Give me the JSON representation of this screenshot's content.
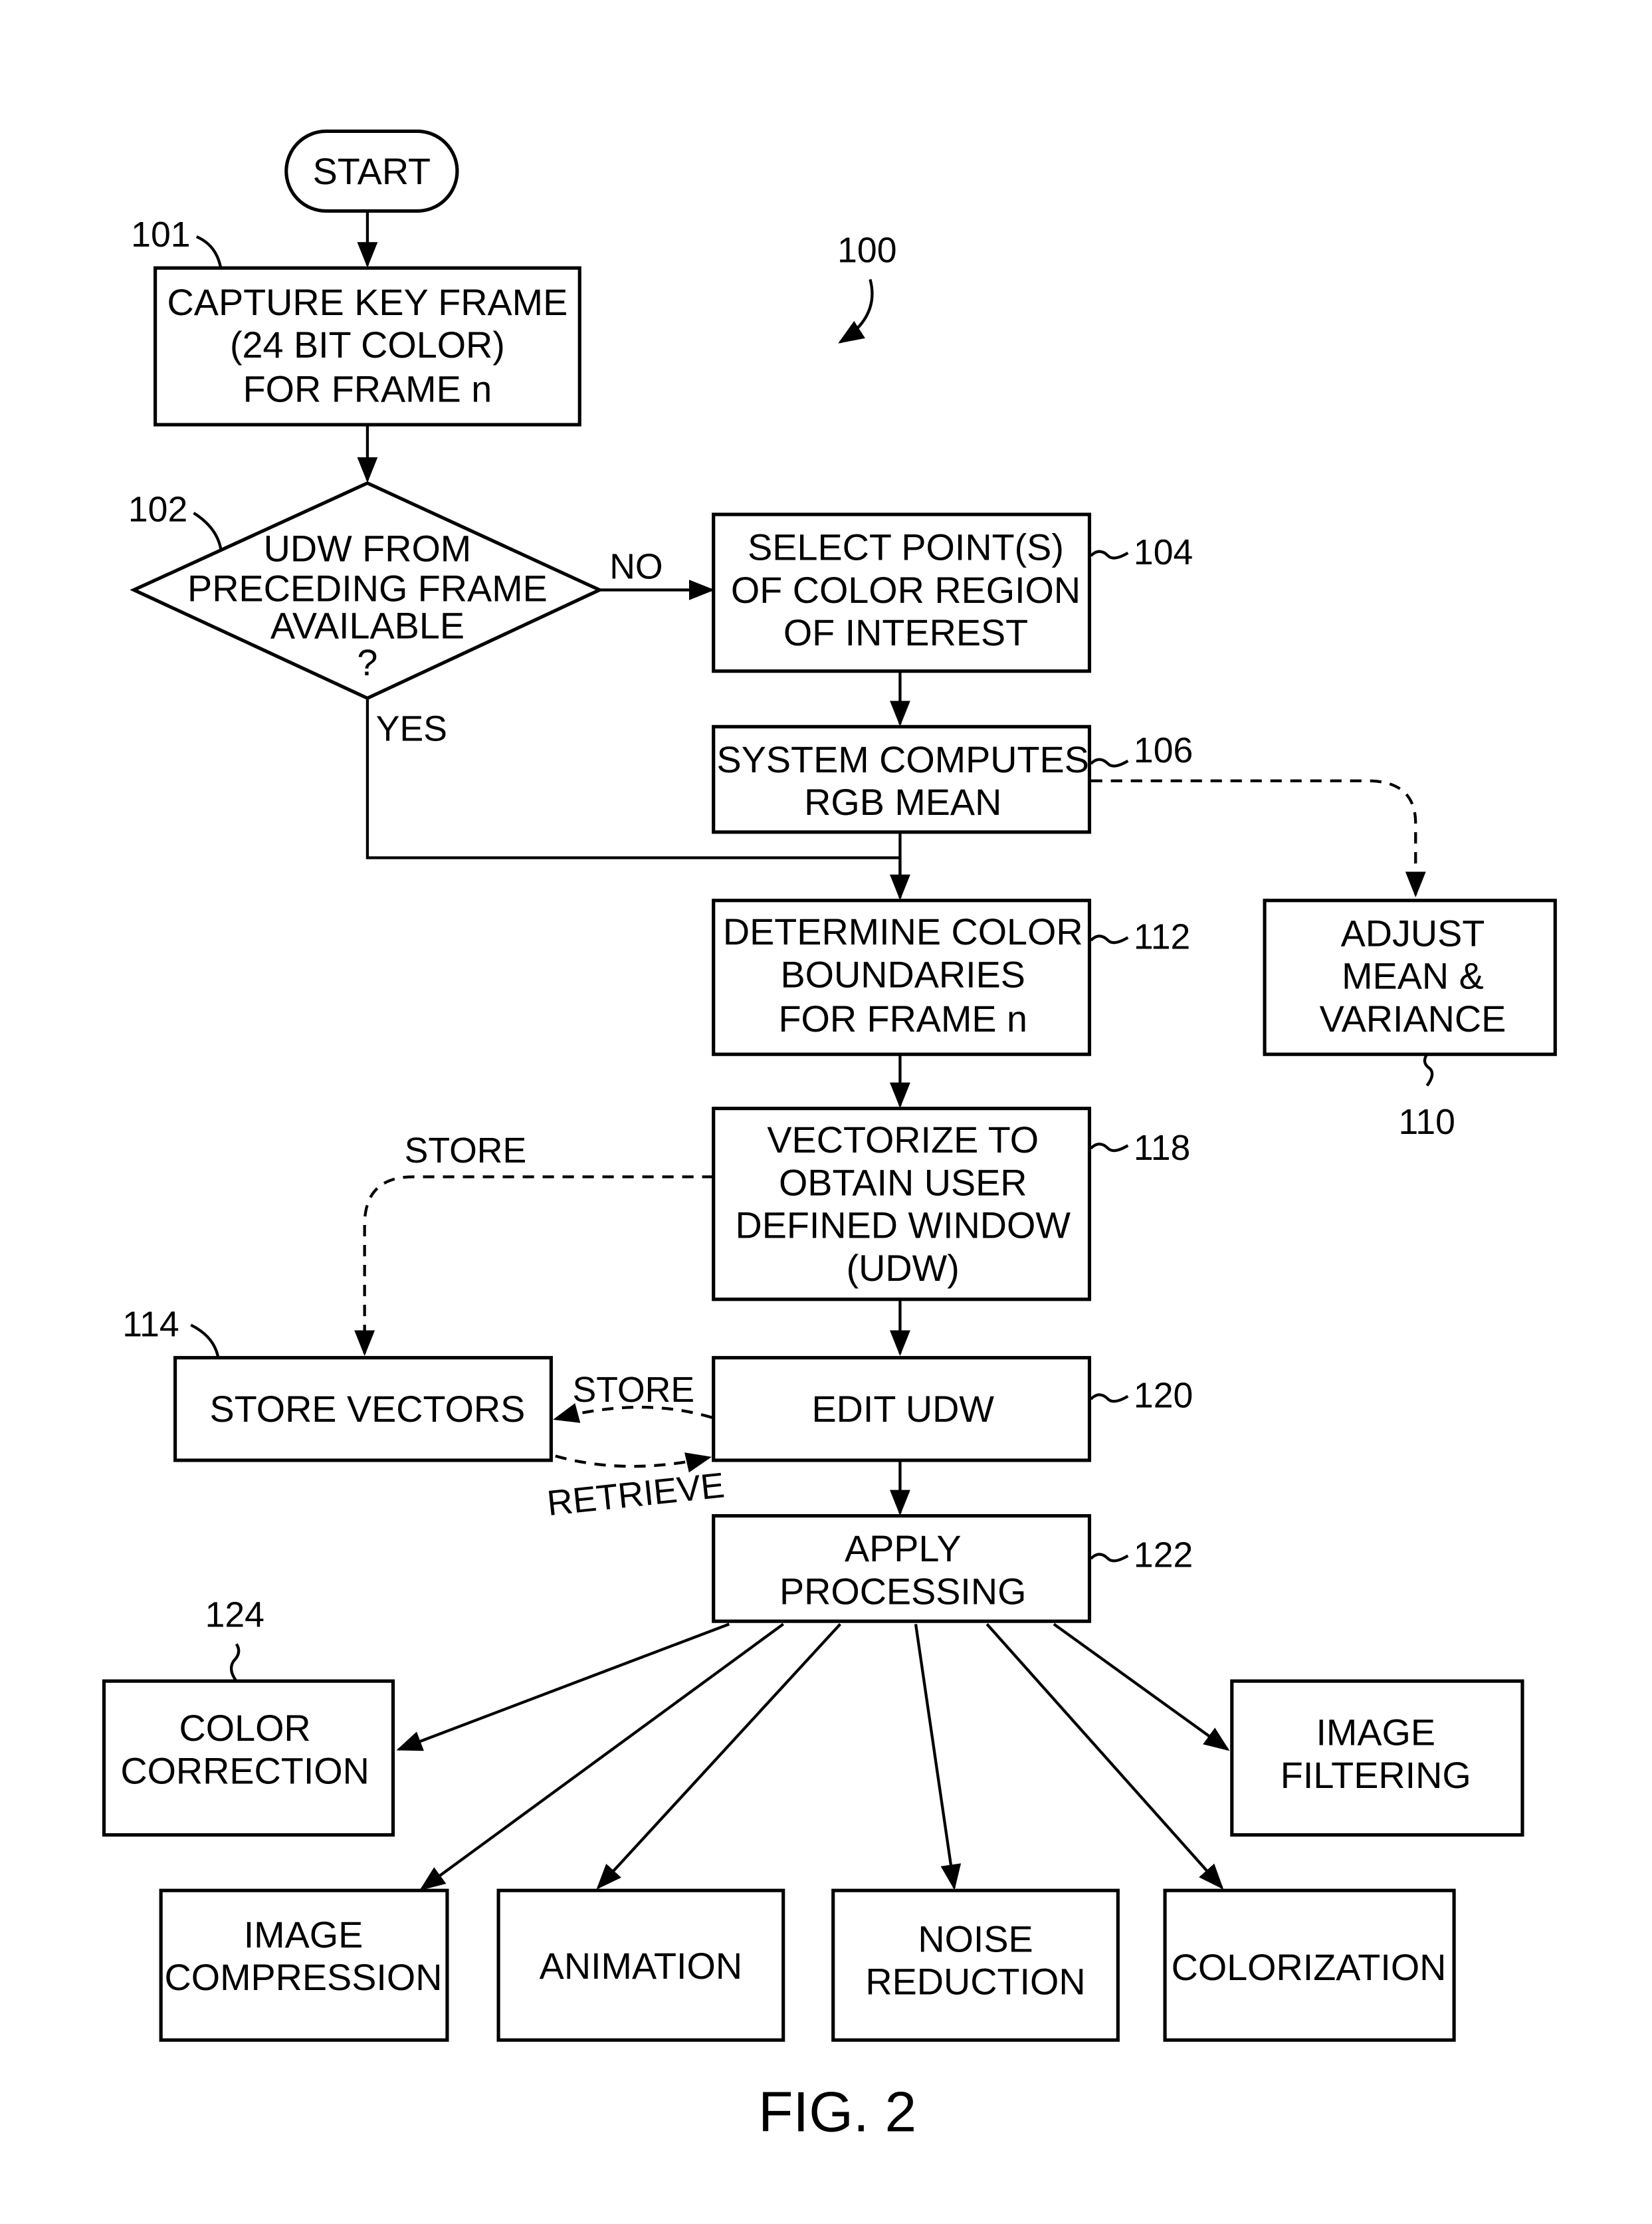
{
  "figure": {
    "caption": "FIG. 2",
    "reference": "100"
  },
  "nodes": {
    "start": {
      "lines": [
        "START"
      ]
    },
    "capture": {
      "ref": "101",
      "lines": [
        "CAPTURE KEY FRAME",
        "(24 BIT COLOR)",
        "FOR FRAME n"
      ]
    },
    "decision": {
      "ref": "102",
      "lines": [
        "UDW FROM",
        "PRECEDING FRAME",
        "AVAILABLE",
        "?"
      ]
    },
    "select": {
      "ref": "104",
      "lines": [
        "SELECT POINT(S)",
        "OF COLOR REGION",
        "OF INTEREST"
      ]
    },
    "compute": {
      "ref": "106",
      "lines": [
        "SYSTEM COMPUTES",
        "RGB MEAN"
      ]
    },
    "adjust": {
      "ref": "110",
      "lines": [
        "ADJUST",
        "MEAN &",
        "VARIANCE"
      ]
    },
    "determine": {
      "ref": "112",
      "lines": [
        "DETERMINE COLOR",
        "BOUNDARIES",
        "FOR FRAME n"
      ]
    },
    "store_vectors": {
      "ref": "114",
      "lines": [
        "STORE VECTORS"
      ]
    },
    "vectorize": {
      "ref": "118",
      "lines": [
        "VECTORIZE TO",
        "OBTAIN USER",
        "DEFINED WINDOW",
        "(UDW)"
      ]
    },
    "edit": {
      "ref": "120",
      "lines": [
        "EDIT UDW"
      ]
    },
    "apply": {
      "ref": "122",
      "lines": [
        "APPLY",
        "PROCESSING"
      ]
    },
    "color_correction": {
      "ref": "124",
      "lines": [
        "COLOR",
        "CORRECTION"
      ]
    },
    "image_filtering": {
      "lines": [
        "IMAGE",
        "FILTERING"
      ]
    },
    "image_compression": {
      "lines": [
        "IMAGE",
        "COMPRESSION"
      ]
    },
    "animation": {
      "lines": [
        "ANIMATION"
      ]
    },
    "noise_reduction": {
      "lines": [
        "NOISE",
        "REDUCTION"
      ]
    },
    "colorization": {
      "lines": [
        "COLORIZATION"
      ]
    }
  },
  "edge_labels": {
    "no": "NO",
    "yes": "YES",
    "store_top": "STORE",
    "store_mid": "STORE",
    "retrieve": "RETRIEVE"
  }
}
